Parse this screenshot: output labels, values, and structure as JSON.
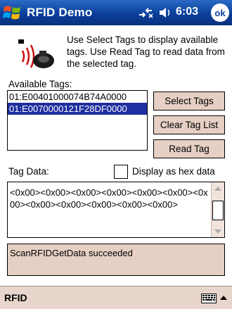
{
  "titlebar": {
    "app_title": "RFID Demo",
    "clock": "6:03",
    "ok_label": "ok",
    "icons": [
      "windows-start-icon",
      "connectivity-icon",
      "volume-icon"
    ]
  },
  "content": {
    "instructions": "Use Select Tags to display available tags.  Use Read Tag to read data from the selected tag.",
    "available_tags_label": "Available Tags:",
    "tags": [
      {
        "text": "01:E00401000074B74A0000",
        "selected": false
      },
      {
        "text": "01:E0070000121F28DF0000",
        "selected": true
      }
    ],
    "buttons": {
      "select_tags": "Select Tags",
      "clear_tag_list": "Clear Tag List",
      "read_tag": "Read Tag"
    },
    "tag_data_label": "Tag Data:",
    "hex_checkbox_label": "Display as hex data",
    "hex_checked": false,
    "tag_data": "<0x00><0x00><0x00><0x00><0x00><0x00><0x00><0x00><0x00><0x00><0x00><0x00>",
    "status": "ScanRFIDGetData succeeded"
  },
  "menubar": {
    "menu_label": "RFID",
    "icons": [
      "keyboard-icon",
      "sip-up-arrow-icon"
    ]
  },
  "colors": {
    "titlebar": "#0a3f9a",
    "selection": "#1f2ea0",
    "button_face": "#e6cfc3",
    "menubar": "#e8d5cb"
  }
}
